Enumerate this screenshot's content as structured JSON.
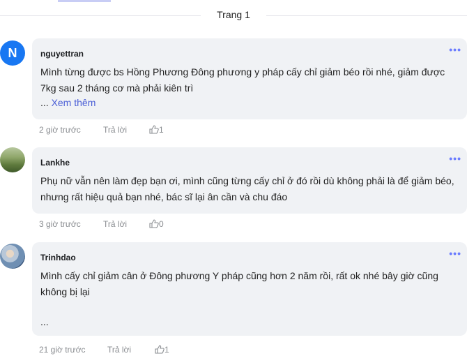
{
  "pagination": {
    "label": "Trang 1"
  },
  "comments": [
    {
      "avatar_letter": "N",
      "author": "nguyettran",
      "text": "Mình từng được bs Hồng Phương Đông phương y pháp cấy chỉ giảm béo rồi nhé, giảm được 7kg sau 2 tháng cơ mà phải kiên trì",
      "see_more_prefix": "...",
      "see_more": "Xem thêm",
      "time": "2 giờ trước",
      "reply": "Trả lời",
      "likes": "1"
    },
    {
      "author": "Lankhe",
      "text": "Phụ nữ vẫn nên làm đẹp bạn ơi, mình cũng từng cấy chỉ ở đó rồi dù không phải là để giảm béo, nhưng rất hiệu quả bạn nhé, bác sĩ lại ân cần và chu đáo",
      "time": "3 giờ trước",
      "reply": "Trả lời",
      "likes": "0"
    },
    {
      "author": "Trinhdao",
      "text": "Mình cấy chỉ giảm cân ở Đông phương Y pháp cũng hơn 2 năm rồi, rất ok nhé bây giờ cũng không bị lại",
      "ellipsis": "...",
      "time": "21 giờ trước",
      "reply": "Trả lời",
      "likes": "1"
    }
  ],
  "icons": {
    "more": "more-dots-icon",
    "like": "thumbs-up-icon"
  },
  "colors": {
    "link": "#4b5fd6",
    "bubble": "#f0f2f5",
    "avatar_bg": "#1877f2"
  }
}
